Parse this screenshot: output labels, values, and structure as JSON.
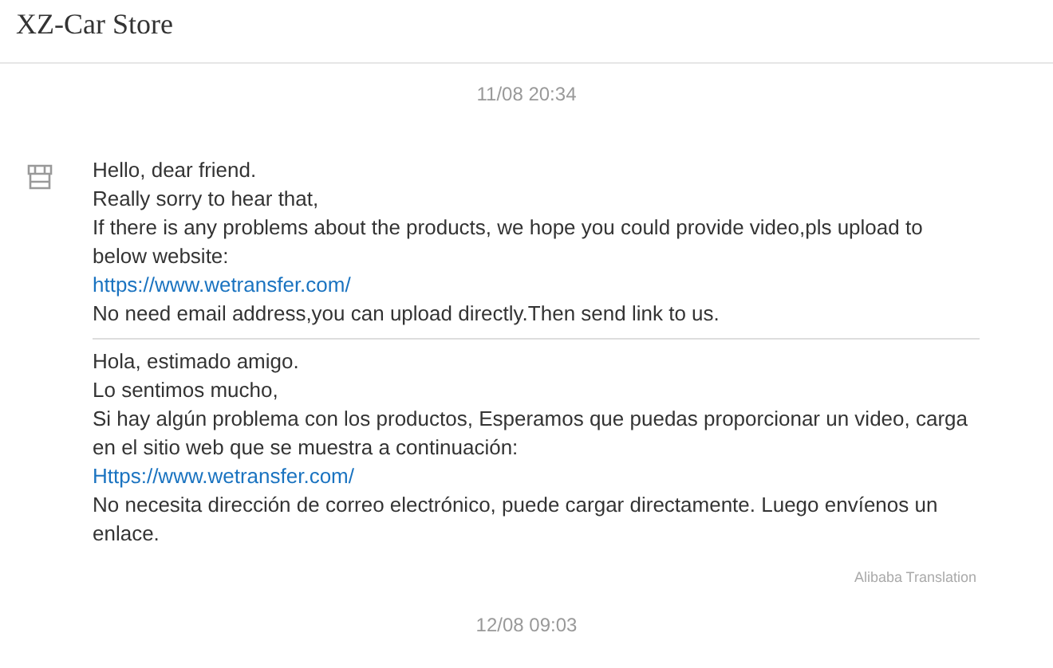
{
  "header": {
    "title": "XZ-Car Store"
  },
  "feed": [
    {
      "kind": "timestamp",
      "text": "11/08 20:34"
    },
    {
      "kind": "message",
      "original": [
        {
          "kind": "text",
          "text": "Hello, dear friend."
        },
        {
          "kind": "text",
          "text": "Really sorry to hear that,"
        },
        {
          "kind": "text",
          "text": "If there is any problems about the products, we hope you could provide video,pls upload to below website:"
        },
        {
          "kind": "link",
          "text": "https://www.wetransfer.com/"
        },
        {
          "kind": "text",
          "text": "No need email address,you can upload directly.Then send link to us."
        }
      ],
      "translation": [
        {
          "kind": "text",
          "text": "Hola, estimado amigo."
        },
        {
          "kind": "text",
          "text": "Lo sentimos mucho,"
        },
        {
          "kind": "text",
          "text": "Si hay algún problema con los productos, Esperamos que puedas proporcionar un video, carga en el sitio web que se muestra a continuación:"
        },
        {
          "kind": "link",
          "text": "Https://www.wetransfer.com/"
        },
        {
          "kind": "text",
          "text": "No necesita dirección de correo electrónico, puede cargar directamente. Luego envíenos un enlace."
        }
      ],
      "credit": "Alibaba Translation"
    },
    {
      "kind": "timestamp",
      "text": "12/08 09:03"
    }
  ]
}
